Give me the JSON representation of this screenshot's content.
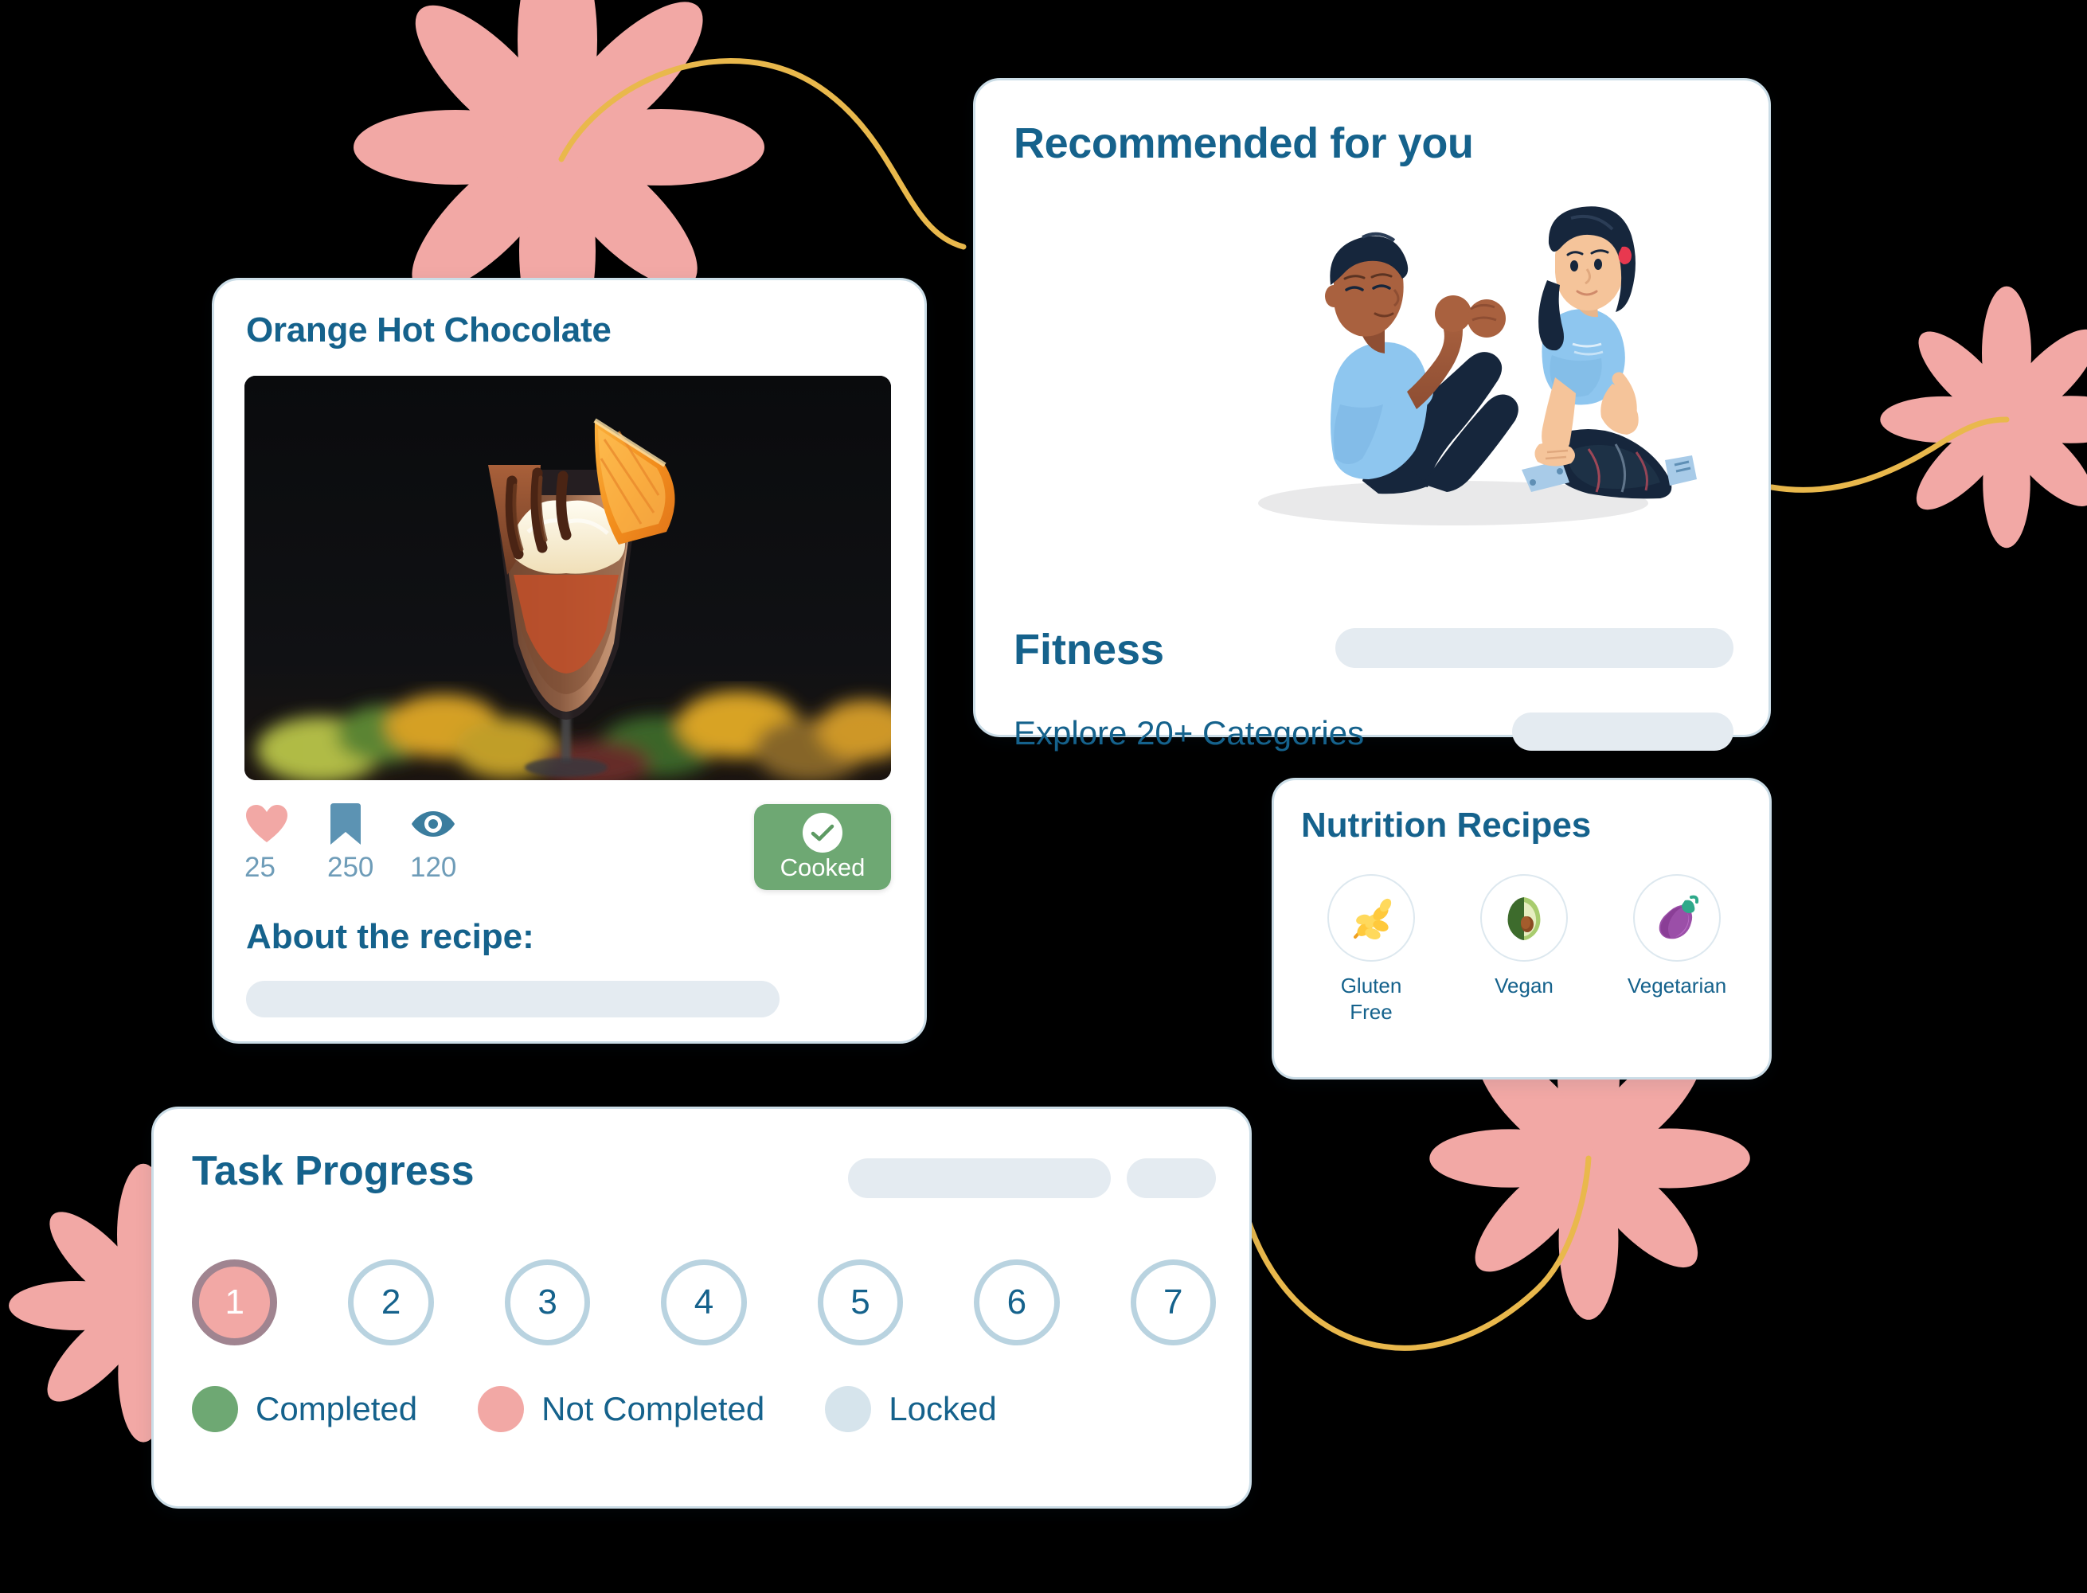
{
  "theme": {
    "background": "#000000",
    "card_background": "#ffffff",
    "card_border": "#cbdde7",
    "brand_blue": "#15628c",
    "skeleton": "#e4ebf1",
    "flower_pink": "#f2a8a5",
    "vine_gold": "#e9b84c",
    "green": "#6ea873",
    "locked_blue": "#b9d3e0",
    "step_current_ring": "#a08490"
  },
  "recipe_card": {
    "title": "Orange Hot Chocolate",
    "photo_alt": "orange-hot-chocolate-dessert-glass",
    "stats": [
      {
        "icon": "heart-icon",
        "name": "likes",
        "value": "25"
      },
      {
        "icon": "bookmark-icon",
        "name": "saves",
        "value": "250"
      },
      {
        "icon": "eye-icon",
        "name": "views",
        "value": "120"
      }
    ],
    "cooked_button": {
      "label": "Cooked",
      "icon": "check-circle-icon"
    },
    "about_heading": "About the recipe:"
  },
  "recommended_card": {
    "title": "Recommended for you",
    "illustration_alt": "two-people-doing-situps",
    "fitness_label": "Fitness",
    "categories_label": "Explore 20+ Categories"
  },
  "nutrition_card": {
    "title": "Nutrition Recipes",
    "items": [
      {
        "icon": "wheat-icon",
        "label": "Gluten\nFree"
      },
      {
        "icon": "avocado-icon",
        "label": "Vegan"
      },
      {
        "icon": "eggplant-icon",
        "label": "Vegetarian"
      }
    ]
  },
  "task_card": {
    "title": "Task Progress",
    "steps": [
      {
        "number": "1",
        "state": "not-completed"
      },
      {
        "number": "2",
        "state": "locked"
      },
      {
        "number": "3",
        "state": "locked"
      },
      {
        "number": "4",
        "state": "locked"
      },
      {
        "number": "5",
        "state": "locked"
      },
      {
        "number": "6",
        "state": "locked"
      },
      {
        "number": "7",
        "state": "locked"
      }
    ],
    "legend": [
      {
        "label": "Completed",
        "color": "#6ea873"
      },
      {
        "label": "Not Completed",
        "color": "#f2a8a5"
      },
      {
        "label": "Locked",
        "color": "#d6e4ec"
      }
    ]
  },
  "decorations": {
    "flowers": [
      "top-left-flower",
      "right-edge-flower",
      "bottom-right-flower",
      "bottom-left-flower"
    ],
    "vines": [
      "top-vine",
      "right-vine",
      "bottom-vine"
    ]
  }
}
